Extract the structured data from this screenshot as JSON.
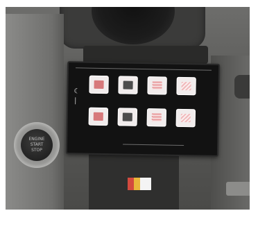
{
  "scene": {
    "start_button": {
      "lines": [
        "ENGINE",
        "START",
        "STOP"
      ]
    },
    "switch_panel": {
      "keys": [
        {
          "icon": "dome-light-icon"
        },
        {
          "icon": "beacon-icon"
        },
        {
          "icon": "work-light-icon"
        },
        {
          "icon": "spot-light-icon"
        },
        {
          "icon": "seat-light-icon"
        },
        {
          "icon": "step-light-icon"
        },
        {
          "icon": "rear-light-icon"
        },
        {
          "icon": "aux-light-icon"
        }
      ]
    }
  }
}
